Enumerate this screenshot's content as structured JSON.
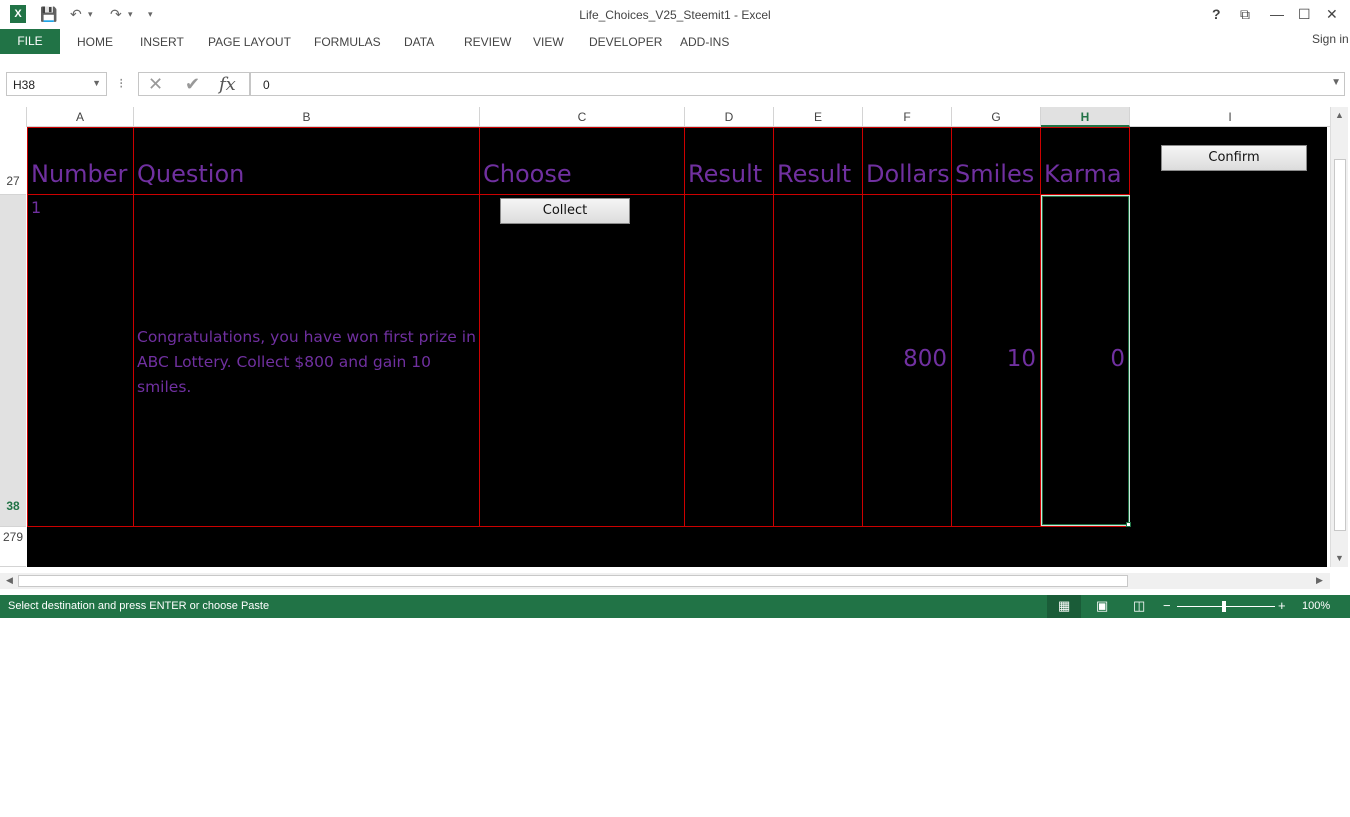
{
  "title": "Life_Choices_V25_Steemit1 - Excel",
  "window_controls": {
    "help": "?",
    "restore_ribbon": "⧉",
    "minimize": "—",
    "maximize": "☐",
    "close": "✕"
  },
  "ribbon": {
    "file": "FILE",
    "tabs": [
      "HOME",
      "INSERT",
      "PAGE LAYOUT",
      "FORMULAS",
      "DATA",
      "REVIEW",
      "VIEW",
      "DEVELOPER",
      "ADD-INS"
    ],
    "sign_in": "Sign in"
  },
  "formula_bar": {
    "name_box": "H38",
    "fx": "fx",
    "value": "0"
  },
  "columns": [
    "A",
    "B",
    "C",
    "D",
    "E",
    "F",
    "G",
    "H",
    "I"
  ],
  "rows": [
    "27",
    "38",
    "279"
  ],
  "table": {
    "headers": [
      "Number",
      "Question",
      "Choose",
      "Result",
      "Result",
      "Dollars",
      "Smiles",
      "Karma"
    ],
    "row": {
      "number": "1",
      "question": "Congratulations, you have won first prize in ABC Lottery. Collect $800 and gain 10 smiles.",
      "dollars": "800",
      "smiles": "10",
      "karma": "0"
    }
  },
  "buttons": {
    "collect": "Collect",
    "confirm": "Confirm"
  },
  "status": {
    "message": "Select destination and press ENTER or choose Paste",
    "zoom": "100%"
  }
}
